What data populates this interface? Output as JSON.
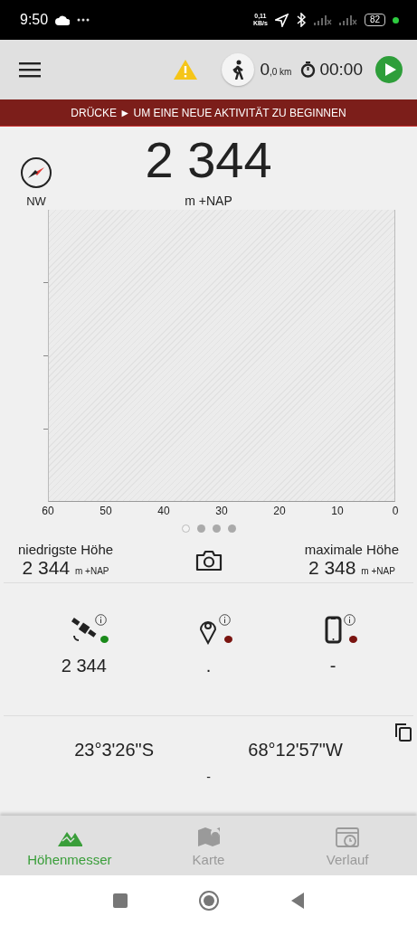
{
  "status_bar": {
    "time": "9:50",
    "net_speed": "0,11",
    "net_unit": "KB/s",
    "battery": "82"
  },
  "toolbar": {
    "distance": "0",
    "distance_unit": ",0 km",
    "timer": "00:00"
  },
  "banner": {
    "before": "DRÜCKE",
    "symbol": "►",
    "after": "UM EINE NEUE AKTIVITÄT ZU BEGINNEN"
  },
  "compass": {
    "direction": "NW"
  },
  "altitude": {
    "value": "2 344",
    "unit": "m +NAP"
  },
  "chart": {
    "x_labels": [
      "60",
      "50",
      "40",
      "30",
      "20",
      "10",
      "0"
    ]
  },
  "pager": [
    {
      "selected": true
    },
    {
      "selected": false
    },
    {
      "selected": false
    },
    {
      "selected": false
    }
  ],
  "stats": [
    {
      "label": "niedrigste Höhe",
      "value": "2 344",
      "unit": "m +NAP"
    },
    {
      "label": "maximale Höhe",
      "value": "2 348",
      "unit": "m +NAP"
    }
  ],
  "sources": [
    {
      "kind": "gps",
      "value": "2 344",
      "color": "#1a8a1a"
    },
    {
      "kind": "location",
      "value": ".",
      "color": "#7a1410"
    },
    {
      "kind": "device",
      "value": "-",
      "color": "#7a1410"
    }
  ],
  "coordinates": {
    "latitude": "23°3'26\"S",
    "longitude": "68°12'57\"W",
    "altitude": "-"
  },
  "tabs": [
    {
      "label": "Höhenmesser",
      "selected": true
    },
    {
      "label": "Karte",
      "selected": false
    },
    {
      "label": "Verlauf",
      "selected": false
    }
  ]
}
